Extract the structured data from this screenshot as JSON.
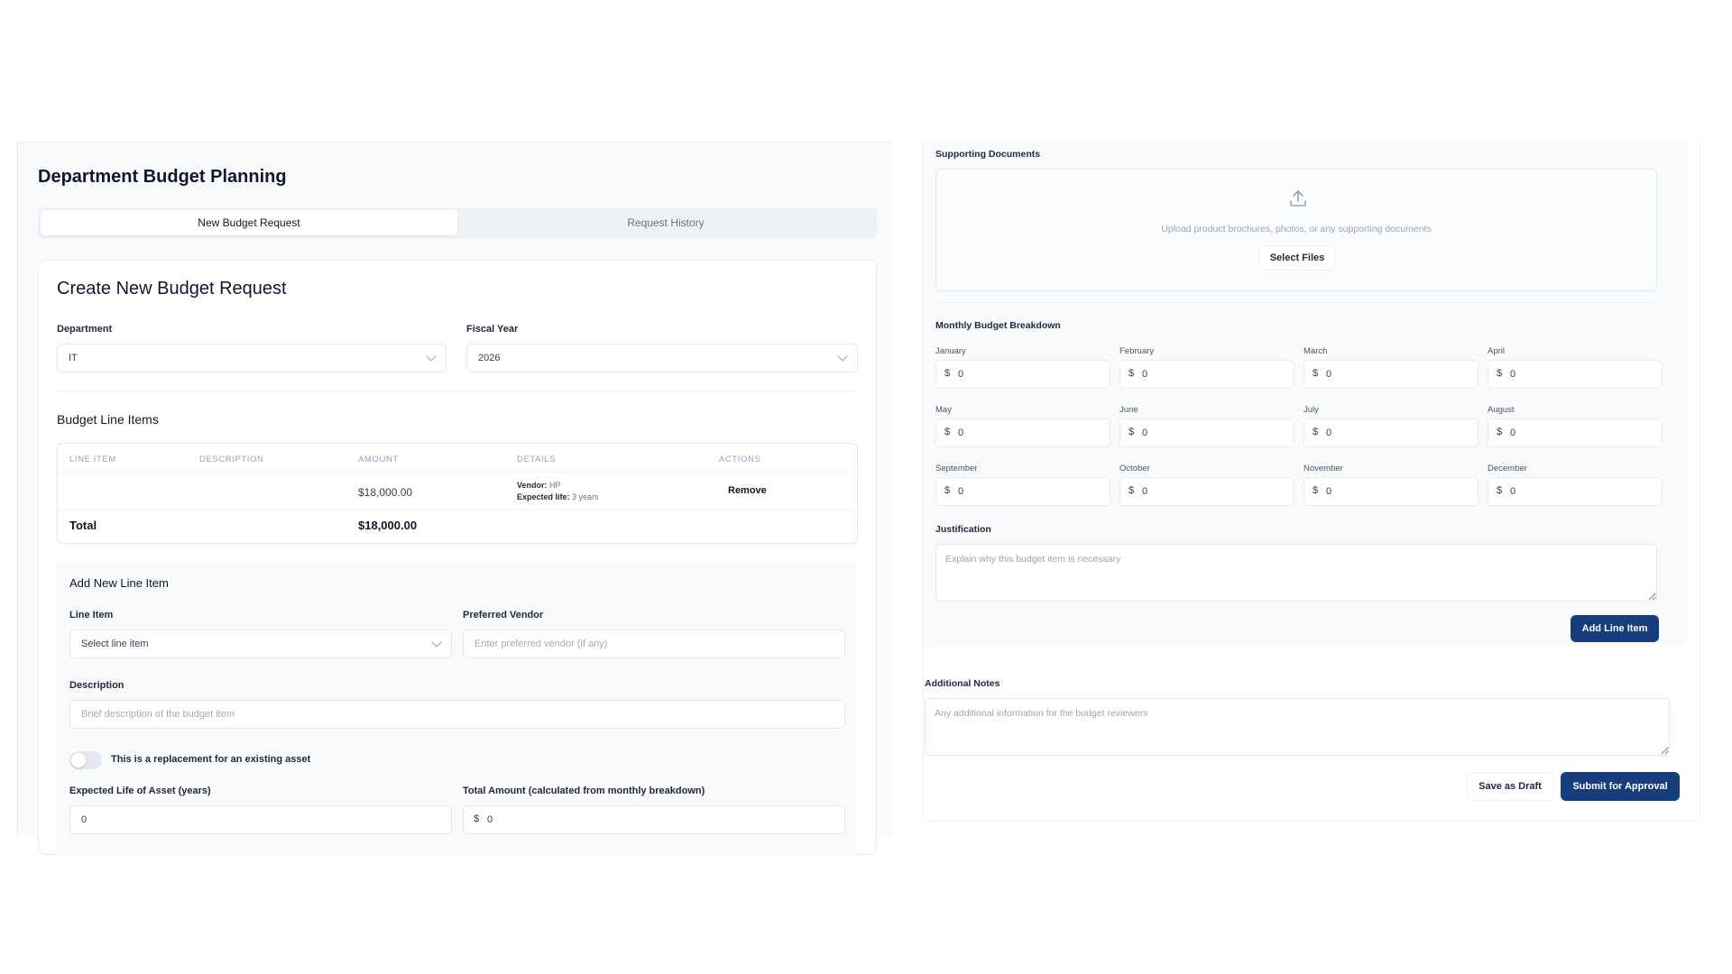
{
  "page": {
    "title": "Department Budget Planning",
    "tabs": [
      {
        "label": "New Budget Request",
        "active": true
      },
      {
        "label": "Request History",
        "active": false
      }
    ]
  },
  "form": {
    "title": "Create New Budget Request",
    "department": {
      "label": "Department",
      "value": "IT"
    },
    "fiscal_year": {
      "label": "Fiscal Year",
      "value": "2026"
    }
  },
  "line_items": {
    "title": "Budget Line Items",
    "columns": [
      "Line Item",
      "Description",
      "Amount",
      "Details",
      "Actions"
    ],
    "rows": [
      {
        "line_item": "",
        "description": "",
        "amount": "$18,000.00",
        "vendor_label": "Vendor:",
        "vendor": "HP",
        "life_label": "Expected life:",
        "life": "3 years",
        "action": "Remove"
      }
    ],
    "total_label": "Total",
    "total_value": "$18,000.00"
  },
  "add_item": {
    "title": "Add New Line Item",
    "line_item": {
      "label": "Line Item",
      "value": "Select line item"
    },
    "vendor": {
      "label": "Preferred Vendor",
      "placeholder": "Enter preferred vendor (if any)"
    },
    "description": {
      "label": "Description",
      "placeholder": "Brief description of the budget item"
    },
    "replacement_toggle": {
      "label": "This is a replacement for an existing asset",
      "on": false
    },
    "expected_life": {
      "label": "Expected Life of Asset (years)",
      "value": "0"
    },
    "total_amount": {
      "label": "Total Amount (calculated from monthly breakdown)",
      "prefix": "$",
      "value": "0"
    }
  },
  "supporting_docs": {
    "label": "Supporting Documents",
    "upload_text": "Upload product brochures, photos, or any supporting documents",
    "button": "Select Files"
  },
  "monthly": {
    "label": "Monthly Budget Breakdown",
    "currency": "$",
    "months": [
      {
        "name": "January",
        "value": "0"
      },
      {
        "name": "February",
        "value": "0"
      },
      {
        "name": "March",
        "value": "0"
      },
      {
        "name": "April",
        "value": "0"
      },
      {
        "name": "May",
        "value": "0"
      },
      {
        "name": "June",
        "value": "0"
      },
      {
        "name": "July",
        "value": "0"
      },
      {
        "name": "August",
        "value": "0"
      },
      {
        "name": "September",
        "value": "0"
      },
      {
        "name": "October",
        "value": "0"
      },
      {
        "name": "November",
        "value": "0"
      },
      {
        "name": "December",
        "value": "0"
      }
    ]
  },
  "justification": {
    "label": "Justification",
    "placeholder": "Explain why this budget item is necessary"
  },
  "add_line_item_button": "Add Line Item",
  "notes": {
    "label": "Additional Notes",
    "placeholder": "Any additional information for the budget reviewers"
  },
  "actions": {
    "save_draft": "Save as Draft",
    "submit": "Submit for Approval"
  },
  "colors": {
    "primary": "#173d7a",
    "panel_bg": "#f8fafc",
    "border": "#e5e7eb"
  }
}
